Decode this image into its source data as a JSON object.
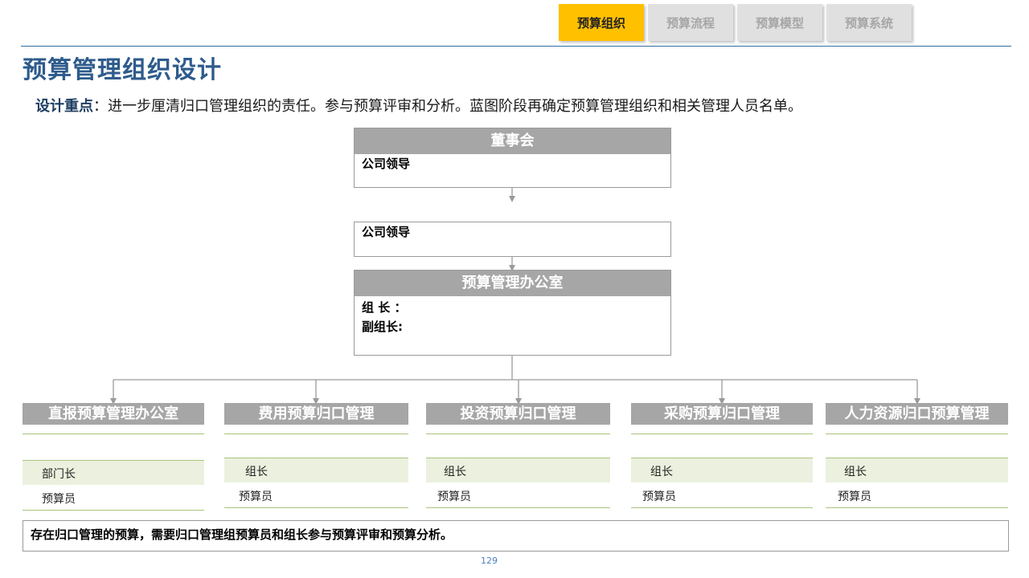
{
  "tabs": [
    "预算组织",
    "预算流程",
    "预算模型",
    "预算系统"
  ],
  "title": "预算管理组织设计",
  "subtitle": {
    "label": "设计重点",
    "text": "：进一步厘清归口管理组织的责任。参与预算评审和分析。蓝图阶段再确定预算管理组织和相关管理人员名单。"
  },
  "board": {
    "header": "董事会",
    "line": "公司领导"
  },
  "leader_box": {
    "line": "公司领导"
  },
  "budget_office": {
    "header": "预算管理办公室",
    "line1": "组 长 ：",
    "line2": "副组长:"
  },
  "departments": [
    {
      "header": "直报预算管理办公室",
      "row1": "部门长",
      "row2": "预算员"
    },
    {
      "header": "费用预算归口管理",
      "row1": "组长",
      "row2": "预算员"
    },
    {
      "header": "投资预算归口管理",
      "row1": "组长",
      "row2": "预算员"
    },
    {
      "header": "采购预算归口管理",
      "row1": "组长",
      "row2": "预算员"
    },
    {
      "header": "人力资源归口预算管理",
      "row1": "组长",
      "row2": "预算员"
    }
  ],
  "note": "存在归口管理的预算，需要归口管理组预算员和组长参与预算评审和预算分析。",
  "page_number": "129",
  "colors": {
    "active_tab": "#ffc000",
    "title": "#2e5b8c",
    "header_gray": "#a6a6a6",
    "green_fill": "#ebf1de"
  }
}
